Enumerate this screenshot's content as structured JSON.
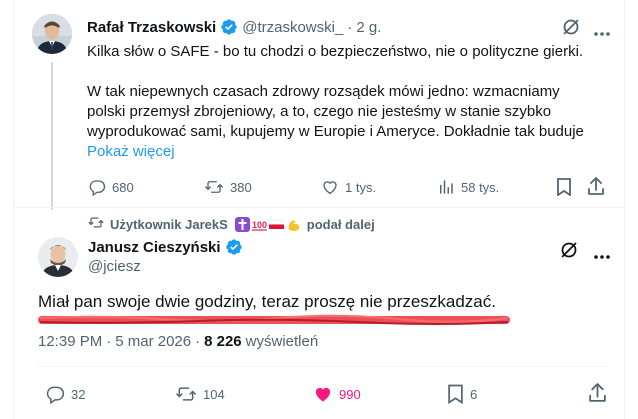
{
  "tweet1": {
    "author_name": "Rafał Trzaskowski",
    "handle": "@trzaskowski_",
    "separator": "·",
    "age": "2 g.",
    "paragraph1": "Kilka słów o SAFE - bo tu chodzi o bezpieczeństwo, nie o polityczne gierki.",
    "paragraph2_lines": [
      "W tak niepewnych czasach zdrowy rozsądek mówi jedno: wzmacniamy",
      "polski przemysł zbrojeniowy, a to, czego nie jesteśmy w stanie szybko",
      "wyprodukować sami, kupujemy w Europie i Ameryce. Dokładnie tak buduje"
    ],
    "show_more": "Pokaż więcej",
    "stats": {
      "replies": "680",
      "reposts": "380",
      "likes": "1 tys.",
      "views": "58 tys."
    }
  },
  "repost_banner": {
    "text": "Użytkownik JarekS",
    "suffix": "podał dalej"
  },
  "tweet2": {
    "author_name": "Janusz Cieszyński",
    "handle": "@jciesz",
    "text": "Miał pan swoje dwie godziny, teraz proszę nie przeszkadzać.",
    "time": "12:39 PM",
    "separator": "·",
    "date": "5 mar 2026",
    "views_count": "8 226",
    "views_label": "wyświetleń",
    "stats": {
      "replies": "32",
      "reposts": "104",
      "likes": "990",
      "bookmarks": "6"
    }
  },
  "colors": {
    "accent": "#1d9bf0",
    "like_active": "#f91880",
    "verified": "#1d9bf0",
    "muted": "#536471",
    "redaction": "#e8303d"
  },
  "icons": [
    "grok-icon",
    "more-icon",
    "reply-icon",
    "repost-icon",
    "like-icon",
    "views-icon",
    "bookmark-icon",
    "share-icon",
    "verified-icon"
  ]
}
